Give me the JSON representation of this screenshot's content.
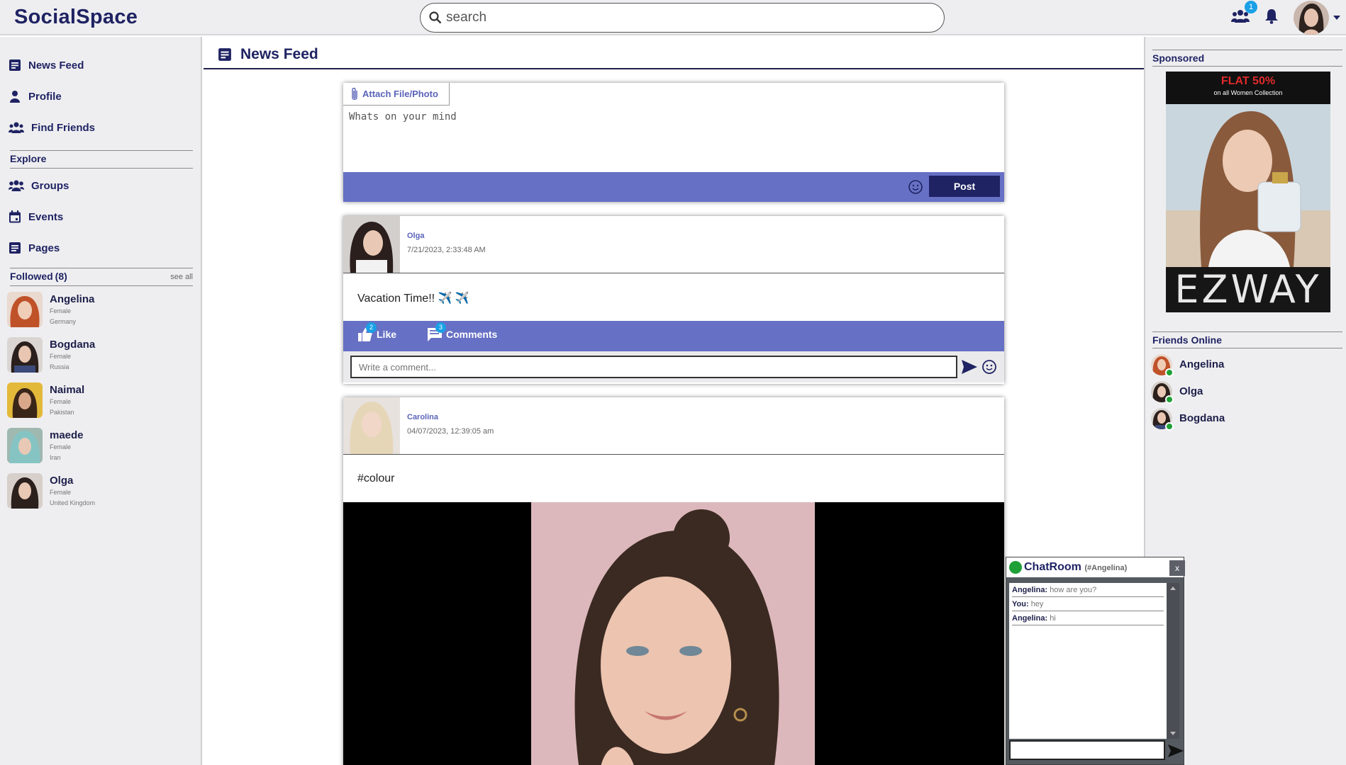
{
  "app": {
    "brand": "SocialSpace"
  },
  "search": {
    "placeholder": "search"
  },
  "topbar": {
    "friend_requests_badge": "1"
  },
  "sidebar": {
    "nav": [
      {
        "label": "News Feed",
        "icon": "newspaper-icon"
      },
      {
        "label": "Profile",
        "icon": "person-icon"
      },
      {
        "label": "Find Friends",
        "icon": "people-icon"
      }
    ],
    "explore_title": "Explore",
    "explore": [
      {
        "label": "Groups",
        "icon": "groups-icon"
      },
      {
        "label": "Events",
        "icon": "calendar-icon"
      },
      {
        "label": "Pages",
        "icon": "pages-icon"
      }
    ],
    "followed_title": "Followed",
    "followed_count": "(8)",
    "see_all": "see all",
    "followed": [
      {
        "name": "Angelina",
        "gender": "Female",
        "country": "Germany"
      },
      {
        "name": "Bogdana",
        "gender": "Female",
        "country": "Russia"
      },
      {
        "name": "Naimal",
        "gender": "Female",
        "country": "Pakistan"
      },
      {
        "name": "maede",
        "gender": "Female",
        "country": "Iran"
      },
      {
        "name": "Olga",
        "gender": "Female",
        "country": "United Kingdom"
      }
    ]
  },
  "feed": {
    "title": "News Feed",
    "composer": {
      "attach_label": "Attach File/Photo",
      "placeholder": "Whats on your mind",
      "post_label": "Post"
    },
    "posts": [
      {
        "author": "Olga",
        "time": "7/21/2023, 2:33:48 AM",
        "text": "Vacation Time!! ✈️ ✈️",
        "like_label": "Like",
        "like_count": "2",
        "comments_label": "Comments",
        "comments_count": "3",
        "comment_placeholder": "Write a comment..."
      },
      {
        "author": "Carolina",
        "time": "04/07/2023, 12:39:05 am",
        "text": "#colour"
      }
    ]
  },
  "right": {
    "sponsored_title": "Sponsored",
    "ad": {
      "headline": "FLAT 50%",
      "subline": "on all Women Collection",
      "brand": "EZWAY"
    },
    "online_title": "Friends Online",
    "online": [
      {
        "name": "Angelina"
      },
      {
        "name": "Olga"
      },
      {
        "name": "Bogdana"
      }
    ]
  },
  "chat": {
    "title": "ChatRoom",
    "subtitle": "(#Angelina)",
    "close_label": "x",
    "messages": [
      {
        "from": "Angelina:",
        "text": "how are you?"
      },
      {
        "from": "You:",
        "text": "hey"
      },
      {
        "from": "Angelina:",
        "text": "hi"
      }
    ]
  },
  "colors": {
    "brand": "#1f2363",
    "accent": "#6670c4",
    "online": "#1fa036",
    "badge": "#1aa0e6"
  }
}
